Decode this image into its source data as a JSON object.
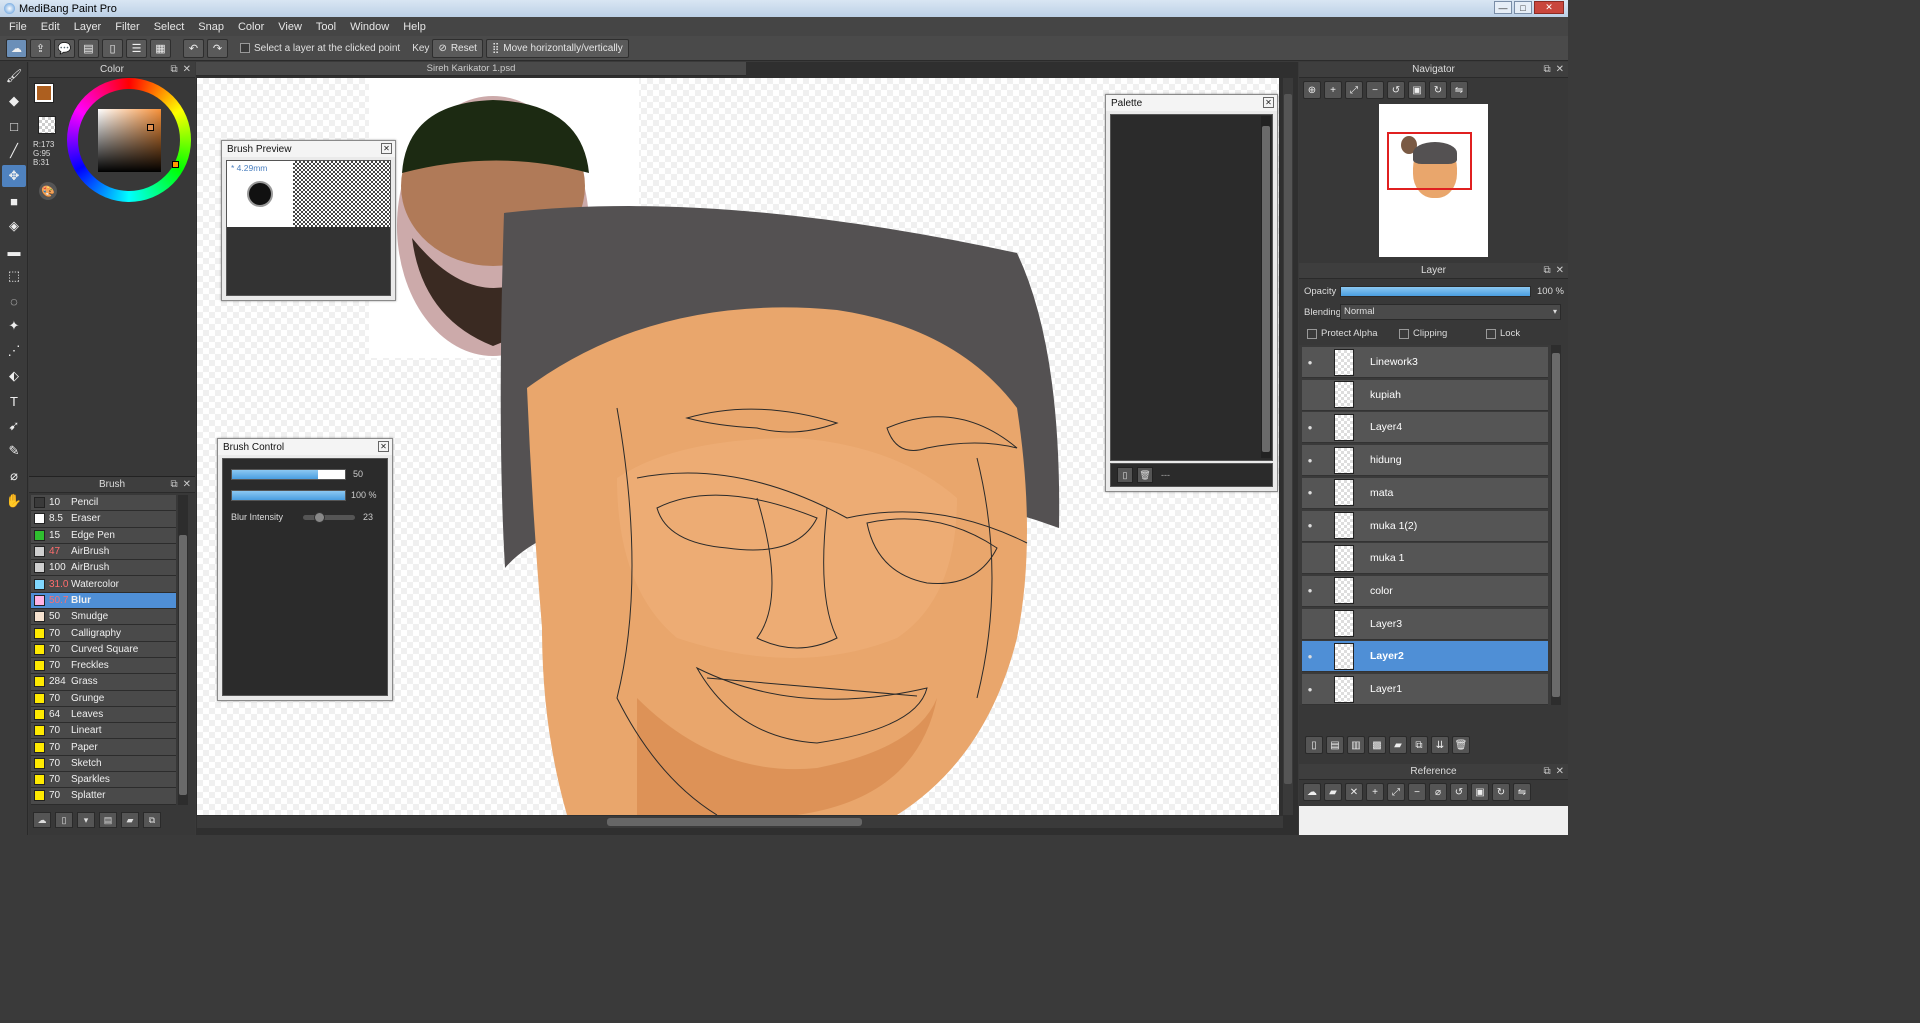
{
  "window": {
    "title": "MediBang Paint Pro",
    "min": "—",
    "max": "□",
    "close": "✕"
  },
  "menu": [
    "File",
    "Edit",
    "Layer",
    "Filter",
    "Select",
    "Snap",
    "Color",
    "View",
    "Tool",
    "Window",
    "Help"
  ],
  "toolbar": {
    "select_layer_label": "Select a layer at the clicked point",
    "key_label": "Key",
    "reset_label": "Reset",
    "move_label": "Move horizontally/vertically"
  },
  "color_panel": {
    "title": "Color",
    "r": "R:173",
    "g": "G:95",
    "b": "B:31",
    "primary": "#ad5f1f"
  },
  "brush_panel": {
    "title": "Brush",
    "items": [
      {
        "size": "10",
        "name": "Pencil",
        "color": "#3a3a3a",
        "red": false
      },
      {
        "size": "8.5",
        "name": "Eraser",
        "color": "#ffffff",
        "red": false
      },
      {
        "size": "15",
        "name": "Edge Pen",
        "color": "#2fbf2f",
        "red": false
      },
      {
        "size": "47",
        "name": "AirBrush",
        "color": "#cfcfcf",
        "red": true
      },
      {
        "size": "100",
        "name": "AirBrush",
        "color": "#cfcfcf",
        "red": false
      },
      {
        "size": "31.0",
        "name": "Watercolor",
        "color": "#7fd7ff",
        "red": true
      },
      {
        "size": "50.7",
        "name": "Blur",
        "color": "#ffb3e6",
        "red": true,
        "selected": true
      },
      {
        "size": "50",
        "name": "Smudge",
        "color": "#f7e3d0",
        "red": false
      },
      {
        "size": "70",
        "name": "Calligraphy",
        "color": "#ffea00",
        "red": false
      },
      {
        "size": "70",
        "name": "Curved Square",
        "color": "#ffea00",
        "red": false
      },
      {
        "size": "70",
        "name": "Freckles",
        "color": "#ffea00",
        "red": false
      },
      {
        "size": "284",
        "name": "Grass",
        "color": "#ffea00",
        "red": false
      },
      {
        "size": "70",
        "name": "Grunge",
        "color": "#ffea00",
        "red": false
      },
      {
        "size": "64",
        "name": "Leaves",
        "color": "#ffea00",
        "red": false
      },
      {
        "size": "70",
        "name": "Lineart",
        "color": "#ffea00",
        "red": false
      },
      {
        "size": "70",
        "name": "Paper",
        "color": "#ffea00",
        "red": false
      },
      {
        "size": "70",
        "name": "Sketch",
        "color": "#ffea00",
        "red": false
      },
      {
        "size": "70",
        "name": "Sparkles",
        "color": "#ffea00",
        "red": false
      },
      {
        "size": "70",
        "name": "Splatter",
        "color": "#ffea00",
        "red": false
      }
    ]
  },
  "document": {
    "tab_title": "Sireh Karikator 1.psd"
  },
  "brush_preview": {
    "title": "Brush Preview",
    "size_label": "* 4.29mm"
  },
  "brush_control": {
    "title": "Brush Control",
    "size_value": "50",
    "size_fraction": 0.76,
    "opacity_value": "100 %",
    "opacity_fraction": 1.0,
    "blur_label": "Blur Intensity",
    "blur_value": "23",
    "blur_fraction": 0.3
  },
  "palette": {
    "title": "Palette",
    "footer": "---"
  },
  "navigator": {
    "title": "Navigator"
  },
  "layer_panel": {
    "title": "Layer",
    "opacity_label": "Opacity",
    "opacity_value": "100 %",
    "blending_label": "Blending",
    "blending_value": "Normal",
    "protect_alpha": "Protect Alpha",
    "clipping": "Clipping",
    "lock": "Lock",
    "layers": [
      {
        "name": "Linework3",
        "visible": true
      },
      {
        "name": "kupiah",
        "visible": false
      },
      {
        "name": "Layer4",
        "visible": true
      },
      {
        "name": "hidung",
        "visible": true
      },
      {
        "name": "mata",
        "visible": true
      },
      {
        "name": "muka 1(2)",
        "visible": true
      },
      {
        "name": "muka 1",
        "visible": false
      },
      {
        "name": "color",
        "visible": true
      },
      {
        "name": "Layer3",
        "visible": false
      },
      {
        "name": "Layer2",
        "visible": true,
        "selected": true
      },
      {
        "name": "Layer1",
        "visible": true
      }
    ]
  },
  "reference": {
    "title": "Reference"
  }
}
